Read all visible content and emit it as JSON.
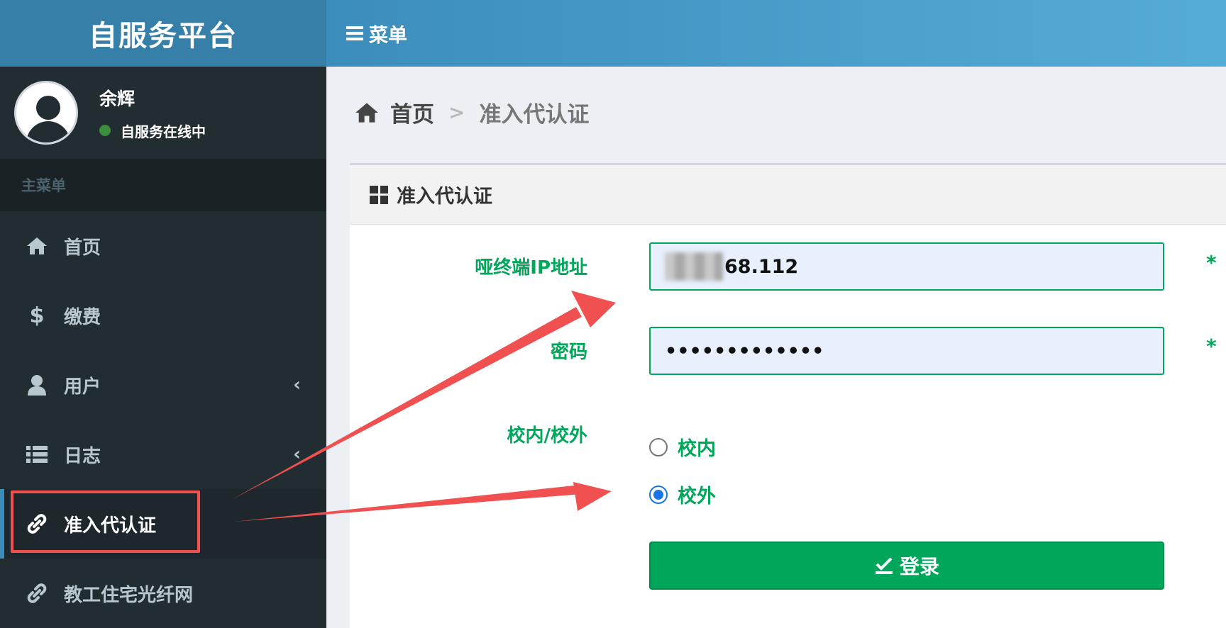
{
  "sidebar": {
    "logo": "自服务平台",
    "user": {
      "name": "余辉",
      "status": "自服务在线中"
    },
    "menu_header": "主菜单",
    "items": [
      {
        "label": "首页",
        "icon": "home-icon"
      },
      {
        "label": "缴费",
        "icon": "dollar-icon"
      },
      {
        "label": "用户",
        "icon": "user-icon",
        "chevron": "‹"
      },
      {
        "label": "日志",
        "icon": "list-icon",
        "chevron": "‹"
      },
      {
        "label": "准入代认证",
        "icon": "link-icon",
        "active": true
      },
      {
        "label": "教工住宅光纤网",
        "icon": "link-icon"
      }
    ]
  },
  "topbar": {
    "menu_label": "菜单"
  },
  "breadcrumb": {
    "home": "首页",
    "separator": ">",
    "current": "准入代认证"
  },
  "box": {
    "title": "准入代认证",
    "form": {
      "ip_label": "哑终端IP地址",
      "ip_value_visible": "68.112",
      "password_label": "密码",
      "password_value": "•••••••••••••",
      "required_mark": "*",
      "location_label": "校内/校外",
      "options": [
        {
          "label": "校内",
          "checked": false
        },
        {
          "label": "校外",
          "checked": true
        }
      ],
      "submit_label": "登录"
    }
  },
  "colors": {
    "sidebar_bg": "#222d32",
    "logo_bg": "#367fa9",
    "accent_green": "#00a65a",
    "annotation_red": "#f05050"
  }
}
